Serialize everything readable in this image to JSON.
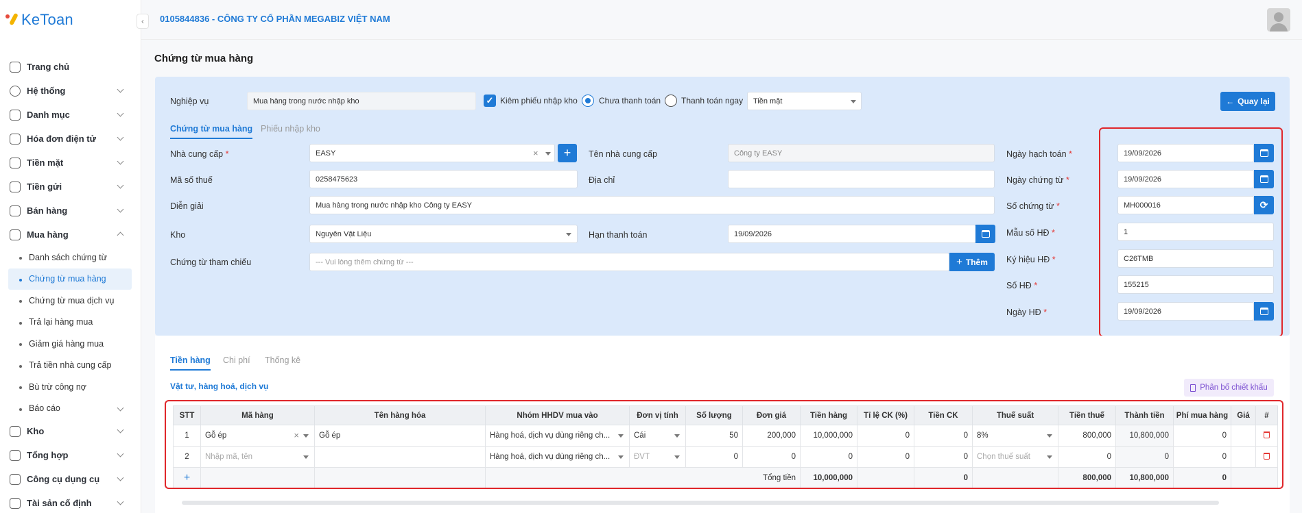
{
  "brand": {
    "name": "KeToan"
  },
  "header": {
    "company": "0105844836 - CÔNG TY CỔ PHẦN MEGABIZ VIỆT NAM"
  },
  "sidebar": {
    "items": [
      {
        "label": "Trang chủ",
        "icon": "home-icon"
      },
      {
        "label": "Hệ thống",
        "icon": "gear-icon"
      },
      {
        "label": "Danh mục",
        "icon": "grid-icon"
      },
      {
        "label": "Hóa đơn điện tử",
        "icon": "invoice-icon"
      },
      {
        "label": "Tiền mặt",
        "icon": "cash-icon"
      },
      {
        "label": "Tiền gửi",
        "icon": "bank-card-icon"
      },
      {
        "label": "Bán hàng",
        "icon": "clipboard-icon"
      },
      {
        "label": "Mua hàng",
        "icon": "bag-icon"
      }
    ],
    "purchase_sub": [
      "Danh sách chứng từ",
      "Chứng từ mua hàng",
      "Chứng từ mua dịch vụ",
      "Trả lại hàng mua",
      "Giảm giá hàng mua",
      "Trả tiền nhà cung cấp",
      "Bù trừ công nợ",
      "Báo cáo"
    ],
    "items_after": [
      {
        "label": "Kho",
        "icon": "warehouse-icon"
      },
      {
        "label": "Tổng hợp",
        "icon": "chart-icon"
      },
      {
        "label": "Công cụ dụng cụ",
        "icon": "tools-icon"
      },
      {
        "label": "Tài sản cố định",
        "icon": "truck-icon"
      }
    ]
  },
  "page": {
    "title": "Chứng từ mua hàng"
  },
  "form": {
    "nghiep_vu_label": "Nghiệp vụ",
    "nghiep_vu_value": "Mua hàng trong nước nhập kho",
    "kiem_phieu_label": "Kiêm phiếu nhập kho",
    "chua_tt_label": "Chưa thanh toán",
    "tt_ngay_label": "Thanh toán ngay",
    "payment_method": "Tiền mặt",
    "back_label": "Quay lại",
    "tabs": [
      "Chứng từ mua hàng",
      "Phiếu nhập kho"
    ],
    "ncc_label": "Nhà cung cấp",
    "ncc_value": "EASY",
    "ten_ncc_label": "Tên nhà cung cấp",
    "ten_ncc_value": "Công ty EASY",
    "mst_label": "Mã số thuế",
    "mst_value": "0258475623",
    "dia_chi_label": "Địa chỉ",
    "dia_chi_value": "",
    "dien_giai_label": "Diễn giải",
    "dien_giai_value": "Mua hàng trong nước nhập kho Công ty EASY",
    "kho_label": "Kho",
    "kho_value": "Nguyên Vật Liệu",
    "han_tt_label": "Hạn thanh toán",
    "han_tt_value": "19/09/2026",
    "ref_label": "Chứng từ tham chiếu",
    "ref_placeholder": "--- Vui lòng thêm chứng từ ---",
    "add_label": "Thêm",
    "right": [
      {
        "label": "Ngày hạch toán",
        "value": "19/09/2026",
        "btn": "calendar"
      },
      {
        "label": "Ngày chứng từ",
        "value": "19/09/2026",
        "btn": "calendar"
      },
      {
        "label": "Số chứng từ",
        "value": "MH000016",
        "btn": "refresh"
      },
      {
        "label": "Mẫu số HĐ",
        "value": "1",
        "btn": ""
      },
      {
        "label": "Ký hiệu HĐ",
        "value": "C26TMB",
        "btn": ""
      },
      {
        "label": "Số HĐ",
        "value": "155215",
        "btn": ""
      },
      {
        "label": "Ngày HĐ",
        "value": "19/09/2026",
        "btn": "calendar"
      }
    ]
  },
  "detail": {
    "tabs": [
      "Tiền hàng",
      "Chi phí",
      "Thống kê"
    ],
    "section_title": "Vật tư, hàng hoá, dịch vụ",
    "allocate_label": "Phân bổ chiết khấu",
    "columns": [
      "STT",
      "Mã hàng",
      "Tên hàng hóa",
      "Nhóm HHDV mua vào",
      "Đơn vị tính",
      "Số lượng",
      "Đơn giá",
      "Tiền hàng",
      "Tỉ lệ CK (%)",
      "Tiền CK",
      "Thuế suất",
      "Tiền thuế",
      "Thành tiền",
      "Phí mua hàng",
      "Giá",
      "#"
    ],
    "rows": [
      {
        "stt": "1",
        "ma": "Gỗ ép",
        "ten": "Gỗ ép",
        "nhom": "Hàng hoá, dịch vụ dùng riêng ch...",
        "dvt": "Cái",
        "sl": "50",
        "dg": "200,000",
        "tien": "10,000,000",
        "tl": "0",
        "ck": "0",
        "thue": "8%",
        "tienthue": "800,000",
        "thanhtien": "10,800,000",
        "phi": "0"
      },
      {
        "stt": "2",
        "ma": "Nhập mã, tên",
        "ten": "",
        "nhom": "Hàng hoá, dịch vụ dùng riêng ch...",
        "dvt": "ĐVT",
        "sl": "0",
        "dg": "0",
        "tien": "0",
        "tl": "0",
        "ck": "0",
        "thue": "Chọn thuế suất",
        "tienthue": "0",
        "thanhtien": "0",
        "phi": "0"
      }
    ],
    "total": {
      "label": "Tổng tiền",
      "tien": "10,000,000",
      "ck": "0",
      "tienthue": "800,000",
      "thanhtien": "10,800,000",
      "phi": "0"
    },
    "add_row": "+"
  },
  "colors": {
    "accent": "#1f7ad6",
    "highlight": "#e0262a",
    "panel": "#dbe9fb"
  }
}
